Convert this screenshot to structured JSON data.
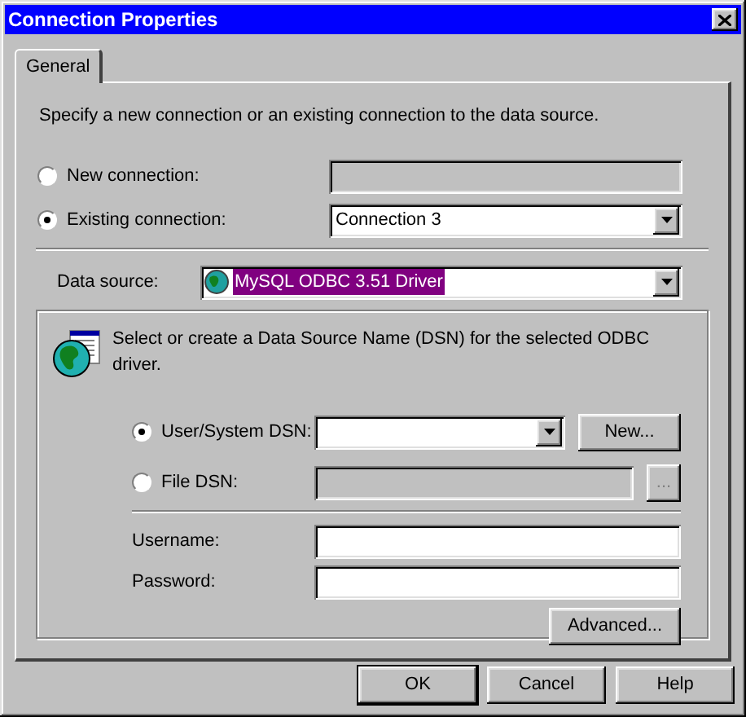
{
  "window": {
    "title": "Connection Properties"
  },
  "tabs": [
    {
      "label": "General",
      "selected": true
    }
  ],
  "intro": "Specify a new connection or an existing connection to the data source.",
  "connection_options": [
    {
      "label": "New connection:",
      "selected": false,
      "kind": "text",
      "disabled": true
    },
    {
      "label": "Existing connection:",
      "selected": true,
      "kind": "dropdown",
      "disabled": false,
      "value": "Connection 3"
    }
  ],
  "data_source": {
    "label": "Data source:",
    "value": "MySQL ODBC 3.51 Driver"
  },
  "dsn_group": {
    "hint": "Select or create a Data Source Name (DSN) for the selected ODBC driver.",
    "options": [
      {
        "label": "User/System DSN:",
        "selected": true,
        "kind": "dropdown",
        "disabled": false,
        "button": "New..."
      },
      {
        "label": "File DSN:",
        "selected": false,
        "kind": "text",
        "disabled": true,
        "button": "..."
      }
    ]
  },
  "credentials": [
    {
      "label": "Username:"
    },
    {
      "label": "Password:"
    }
  ],
  "advanced_button": "Advanced...",
  "buttons": [
    {
      "label": "OK",
      "default": true
    },
    {
      "label": "Cancel",
      "default": false
    },
    {
      "label": "Help",
      "default": false
    }
  ]
}
